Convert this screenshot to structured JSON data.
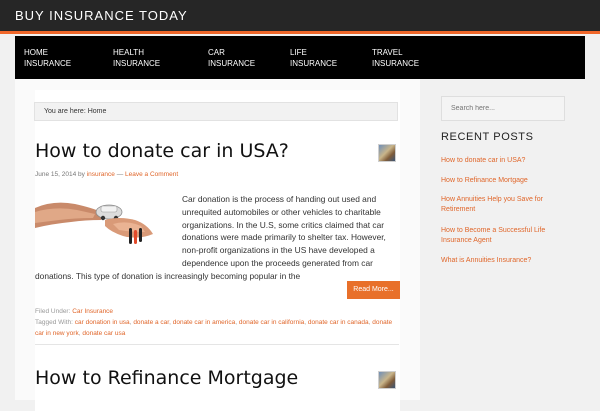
{
  "site": {
    "title": "BUY INSURANCE TODAY"
  },
  "nav": [
    {
      "line1": "HOME",
      "line2": "INSURANCE"
    },
    {
      "line1": "HEALTH",
      "line2": "INSURANCE"
    },
    {
      "line1": "CAR",
      "line2": "INSURANCE"
    },
    {
      "line1": "LIFE",
      "line2": "INSURANCE"
    },
    {
      "line1": "TRAVEL",
      "line2": "INSURANCE"
    }
  ],
  "breadcrumb": "You are here: Home",
  "posts": [
    {
      "title": "How to donate car in USA?",
      "date": "June 15, 2014",
      "by": "by",
      "author": "insurance",
      "sep": "—",
      "comment": "Leave a Comment",
      "excerpt": "Car donation is the process of handing out used and unrequited automobiles or other vehicles to charitable organizations. In the U.S, some critics claimed that car donations were made primarily to shelter tax. However, non-profit organizations in the US have developed a dependence upon the proceeds generated from car donations. This type of donation is increasingly becoming popular in the",
      "read_more": "Read More...",
      "filed_label": "Filed Under:",
      "category": "Car Insurance",
      "tagged_label": "Tagged With:",
      "tags": [
        "car donation in usa",
        "donate a car",
        "donate car in america",
        "donate car in california",
        "donate car in canada",
        "donate car in new york",
        "donate car usa"
      ]
    },
    {
      "title": "How to Refinance Mortgage"
    }
  ],
  "sidebar": {
    "search_placeholder": "Search here...",
    "recent_title": "RECENT POSTS",
    "recent_posts": [
      "How to donate car in USA?",
      "How to Refinance Mortgage",
      "How Annuities Help you Save for Retirement",
      "How to Become a Successful Life Insurance Agent",
      "What is Annuities Insurance?"
    ]
  },
  "colors": {
    "accent": "#e8702a",
    "topbar": "#262626",
    "nav": "#000000"
  }
}
